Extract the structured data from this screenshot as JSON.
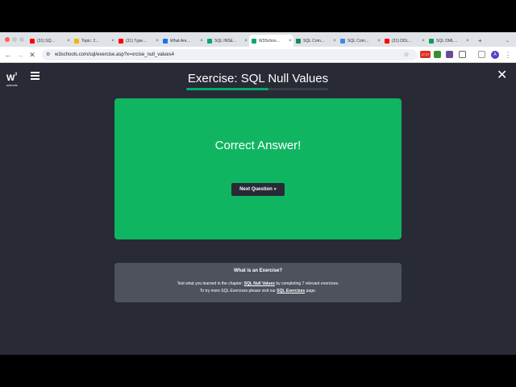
{
  "browser": {
    "tabs": [
      {
        "title": "(31) SQ…",
        "favicon_color": "#ff0000"
      },
      {
        "title": "Topic: 2…",
        "favicon_color": "#f4b400"
      },
      {
        "title": "(31) Type…",
        "favicon_color": "#ff0000"
      },
      {
        "title": "What Are…",
        "favicon_color": "#1a73e8"
      },
      {
        "title": "SQL INSE…",
        "favicon_color": "#04AA6D"
      },
      {
        "title": "W3Schoo…",
        "favicon_color": "#04AA6D",
        "active": true
      },
      {
        "title": "SQL Com…",
        "favicon_color": "#1b8a5a"
      },
      {
        "title": "SQL Com…",
        "favicon_color": "#4285f4"
      },
      {
        "title": "(31) DDL…",
        "favicon_color": "#ff0000"
      },
      {
        "title": "SQL DML…",
        "favicon_color": "#0f9d58"
      }
    ],
    "new_tab": "+",
    "url": "w3schools.com/sql/exercise.asp?x=xrcise_null_values4",
    "ext_badge": "27.27",
    "profile_initial": "A"
  },
  "site": {
    "logo_text": "W",
    "logo_sup": "3",
    "logo_small": "schools"
  },
  "exercise": {
    "title": "Exercise: SQL Null Values",
    "progress_fraction": 0.58,
    "result": "Correct Answer!",
    "next_button": "Next Question »"
  },
  "info": {
    "heading": "What is an Exercise?",
    "line1_pre": "Test what you learned in the chapter: ",
    "line1_link": "SQL Null Values",
    "line1_post": " by completing 7 relevant exercises.",
    "line2_pre": "To try more SQL Exercises please visit our ",
    "line2_link": "SQL Exercises",
    "line2_post": " page."
  },
  "colors": {
    "accent": "#04AA6D",
    "card": "#10B562",
    "page_bg": "#282A35"
  }
}
